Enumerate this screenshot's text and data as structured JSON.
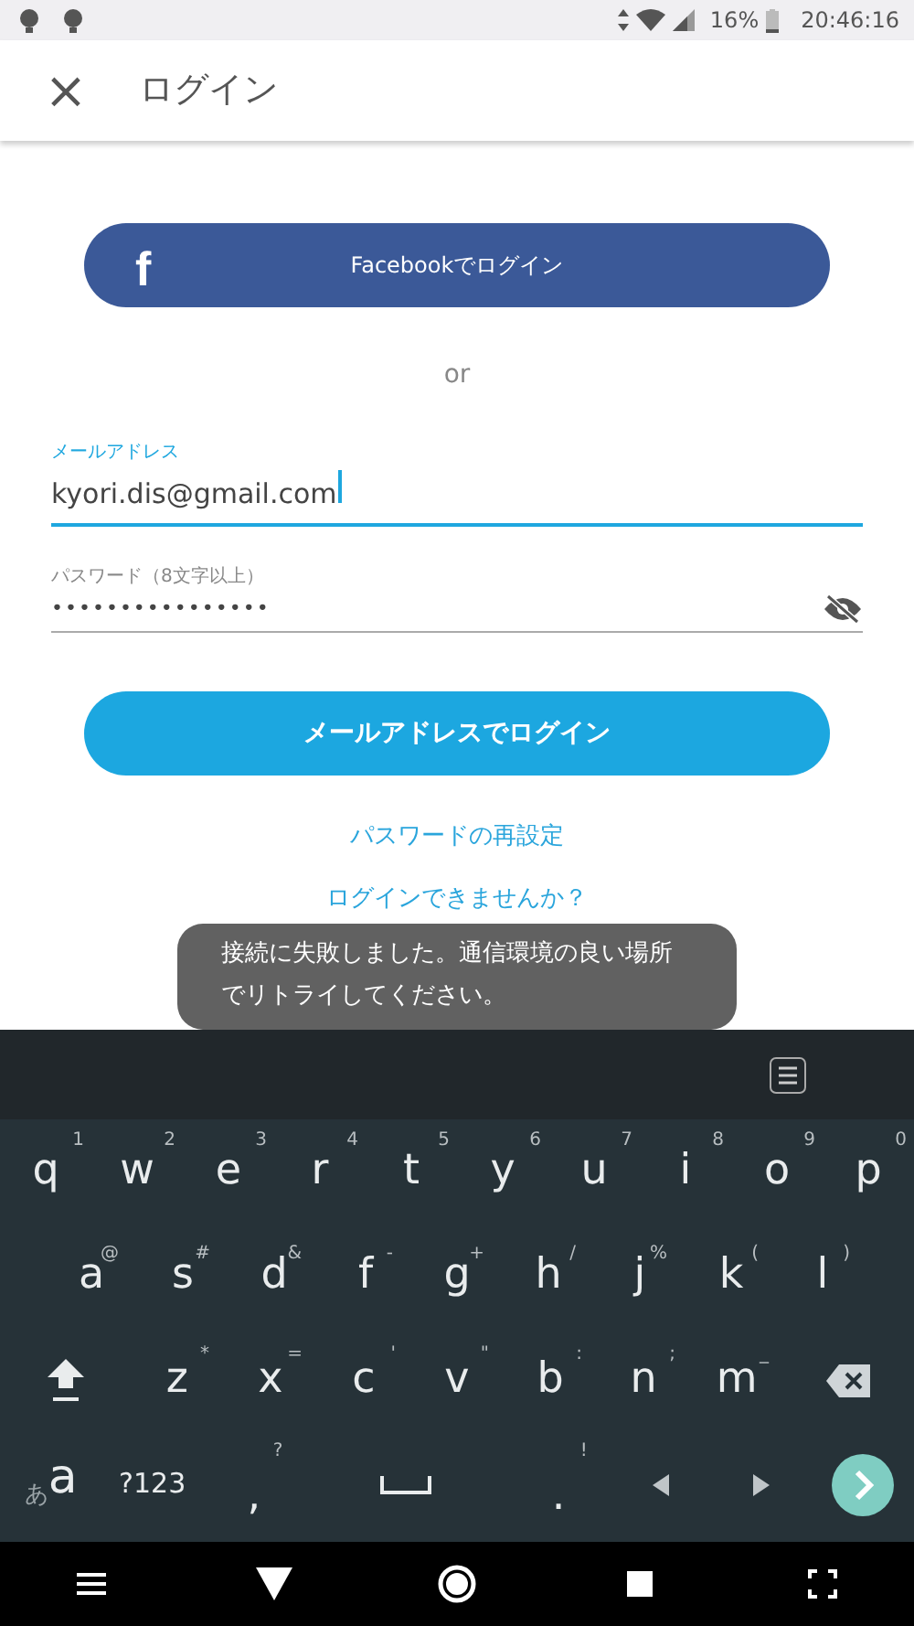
{
  "status_bar": {
    "battery": "16%",
    "time": "20:46:16"
  },
  "app_bar": {
    "close": "×",
    "title": "ログイン"
  },
  "facebook_button": {
    "icon": "f",
    "label": "Facebookでログイン"
  },
  "divider_text": "or",
  "email": {
    "label": "メールアドレス",
    "value": "kyori.dis@gmail.com",
    "focused": true
  },
  "password": {
    "label": "パスワード（8文字以上）",
    "value": "••••••••••••••••",
    "focused": false
  },
  "login_button": "メールアドレスでログイン",
  "reset_link": "パスワードの再設定",
  "help_link": "ログインできませんか？",
  "toast": "接続に失敗しました。通信環境の良い場所でリトライしてください。",
  "keyboard": {
    "rows": [
      {
        "keys": [
          {
            "kind": "char",
            "label": "q",
            "hint": "1"
          },
          {
            "kind": "char",
            "label": "w",
            "hint": "2"
          },
          {
            "kind": "char",
            "label": "e",
            "hint": "3"
          },
          {
            "kind": "char",
            "label": "r",
            "hint": "4"
          },
          {
            "kind": "char",
            "label": "t",
            "hint": "5"
          },
          {
            "kind": "char",
            "label": "y",
            "hint": "6"
          },
          {
            "kind": "char",
            "label": "u",
            "hint": "7"
          },
          {
            "kind": "char",
            "label": "i",
            "hint": "8"
          },
          {
            "kind": "char",
            "label": "o",
            "hint": "9"
          },
          {
            "kind": "char",
            "label": "p",
            "hint": "0"
          }
        ]
      },
      {
        "keys": [
          {
            "kind": "char",
            "label": "a",
            "hint": "@"
          },
          {
            "kind": "char",
            "label": "s",
            "hint": "#"
          },
          {
            "kind": "char",
            "label": "d",
            "hint": "&"
          },
          {
            "kind": "char",
            "label": "f",
            "hint": "-"
          },
          {
            "kind": "char",
            "label": "g",
            "hint": "+"
          },
          {
            "kind": "char",
            "label": "h",
            "hint": "/"
          },
          {
            "kind": "char",
            "label": "j",
            "hint": "%"
          },
          {
            "kind": "char",
            "label": "k",
            "hint": "("
          },
          {
            "kind": "char",
            "label": "l",
            "hint": ")"
          }
        ]
      },
      {
        "keys": [
          {
            "kind": "shift"
          },
          {
            "kind": "char",
            "label": "z",
            "hint": "*"
          },
          {
            "kind": "char",
            "label": "x",
            "hint": "="
          },
          {
            "kind": "char",
            "label": "c",
            "hint": "'"
          },
          {
            "kind": "char",
            "label": "v",
            "hint": "\""
          },
          {
            "kind": "char",
            "label": "b",
            "hint": ":"
          },
          {
            "kind": "char",
            "label": "n",
            "hint": ";"
          },
          {
            "kind": "char",
            "label": "m",
            "hint": "_"
          },
          {
            "kind": "backspace"
          }
        ]
      },
      {
        "keys": [
          {
            "kind": "lang",
            "small": "あ",
            "label": "a"
          },
          {
            "kind": "symbols",
            "label": "?123"
          },
          {
            "kind": "char",
            "label": ",",
            "hint": "?"
          },
          {
            "kind": "space"
          },
          {
            "kind": "char",
            "label": ".",
            "hint": "!"
          },
          {
            "kind": "left"
          },
          {
            "kind": "right"
          },
          {
            "kind": "enter"
          }
        ]
      }
    ]
  }
}
